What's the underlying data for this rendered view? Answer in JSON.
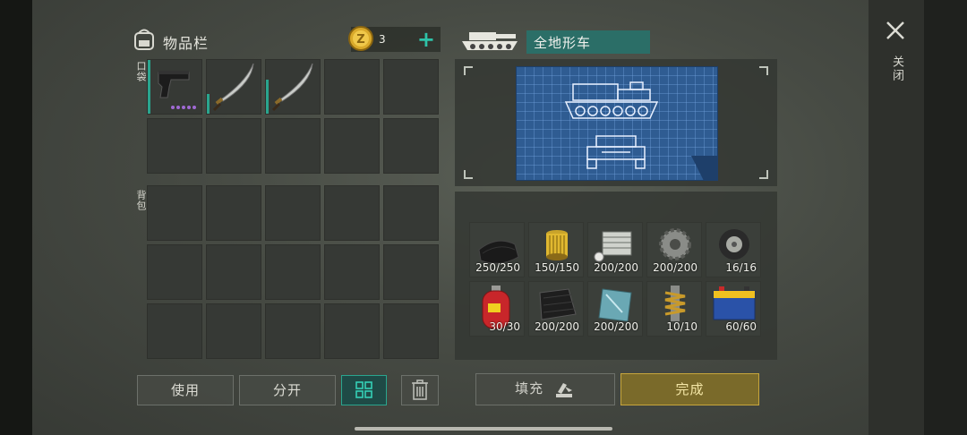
{
  "inventory": {
    "title": "物品栏",
    "coins": "3",
    "plus_label": "+",
    "pocket_label": "口袋",
    "backpack_label": "背包",
    "pocket_slots": [
      {
        "item": "pistol-icon",
        "durability": 1.0,
        "rarity_dots": 5
      },
      {
        "item": "katana-icon",
        "durability": 0.35
      },
      {
        "item": "katana-icon",
        "durability": 0.6
      },
      {
        "item": ""
      },
      {
        "item": ""
      },
      {
        "item": ""
      },
      {
        "item": ""
      },
      {
        "item": ""
      },
      {
        "item": ""
      },
      {
        "item": ""
      }
    ],
    "backpack_slots": 15
  },
  "vehicle": {
    "name": "全地形车",
    "icon": "tank-icon"
  },
  "parts": [
    {
      "icon": "rubber-icon",
      "qty": "250/250"
    },
    {
      "icon": "oil-filter-icon",
      "qty": "150/150"
    },
    {
      "icon": "engine-block-icon",
      "qty": "200/200"
    },
    {
      "icon": "gear-icon",
      "qty": "200/200"
    },
    {
      "icon": "wheel-icon",
      "qty": "16/16"
    },
    {
      "icon": "gas-cylinder-icon",
      "qty": "30/30"
    },
    {
      "icon": "carbon-fabric-icon",
      "qty": "200/200"
    },
    {
      "icon": "glass-sheet-icon",
      "qty": "200/200"
    },
    {
      "icon": "shock-absorber-icon",
      "qty": "10/10"
    },
    {
      "icon": "battery-icon",
      "qty": "60/60"
    }
  ],
  "buttons": {
    "use": "使用",
    "split": "分开",
    "fill": "填充",
    "done": "完成",
    "close": "关闭"
  },
  "colors": {
    "accent": "#2aa58e",
    "gold": "#c7a63c",
    "blueprint": "#2f5c92"
  }
}
